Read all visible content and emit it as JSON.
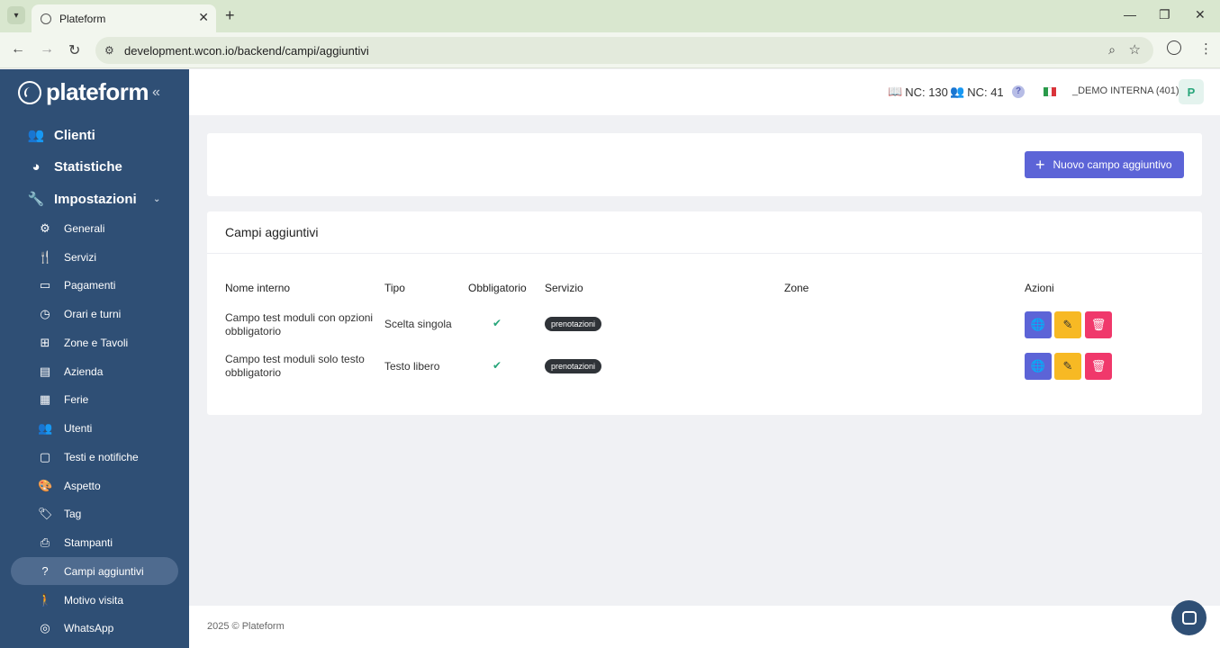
{
  "browser": {
    "tab_title": "Plateform",
    "close_tab": "✕",
    "new_tab": "+",
    "url": "development.wcon.io/backend/campi/aggiuntivi",
    "minimize": "—",
    "restore": "❐",
    "close_window": "✕"
  },
  "sidebar": {
    "logo": "plateform",
    "collapse": "«",
    "main": [
      {
        "label": "Clienti",
        "icon": "users-icon"
      },
      {
        "label": "Statistiche",
        "icon": "pie-chart-icon"
      },
      {
        "label": "Impostazioni",
        "icon": "wrench-icon"
      }
    ],
    "sub": [
      {
        "label": "Generali",
        "icon": "gear-icon"
      },
      {
        "label": "Servizi",
        "icon": "utensils-icon"
      },
      {
        "label": "Pagamenti",
        "icon": "credit-card-icon"
      },
      {
        "label": "Orari e turni",
        "icon": "clock-icon"
      },
      {
        "label": "Zone e Tavoli",
        "icon": "grid-icon"
      },
      {
        "label": "Azienda",
        "icon": "building-icon"
      },
      {
        "label": "Ferie",
        "icon": "calendar-icon"
      },
      {
        "label": "Utenti",
        "icon": "users-icon"
      },
      {
        "label": "Testi e notifiche",
        "icon": "message-icon"
      },
      {
        "label": "Aspetto",
        "icon": "palette-icon"
      },
      {
        "label": "Tag",
        "icon": "tags-icon"
      },
      {
        "label": "Stampanti",
        "icon": "printer-icon"
      },
      {
        "label": "Campi aggiuntivi",
        "icon": "question-icon"
      },
      {
        "label": "Motivo visita",
        "icon": "walking-icon"
      },
      {
        "label": "WhatsApp",
        "icon": "whatsapp-icon"
      }
    ]
  },
  "topbar": {
    "nc_book": "NC: 130",
    "nc_users": "NC: 41",
    "help": "?",
    "account": "_DEMO INTERNA (401)",
    "avatar": "P"
  },
  "actions": {
    "new_button": "Nuovo campo aggiuntivo"
  },
  "table": {
    "title": "Campi aggiuntivi",
    "headers": [
      "Nome interno",
      "Tipo",
      "Obbligatorio",
      "Servizio",
      "Zone",
      "Azioni"
    ],
    "rows": [
      {
        "name_line1": "Campo test moduli con opzioni",
        "name_line2": "obbligatorio",
        "tipo": "Scelta singola",
        "obbligatorio": "✔",
        "servizio": "prenotazioni",
        "zone": ""
      },
      {
        "name_line1": "Campo test moduli solo testo",
        "name_line2": "obbligatorio",
        "tipo": "Testo libero",
        "obbligatorio": "✔",
        "servizio": "prenotazioni",
        "zone": ""
      }
    ]
  },
  "footer": {
    "text": "2025 © Plateform"
  },
  "colors": {
    "sidebar_bg": "#2f4f75",
    "primary": "#5c64d7",
    "warning": "#f7b924",
    "danger": "#f0386b",
    "success": "#27a57a"
  }
}
